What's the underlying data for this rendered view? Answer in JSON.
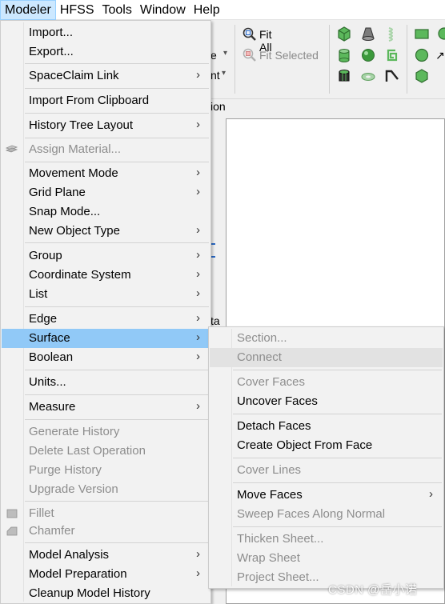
{
  "menubar": {
    "items": [
      "Modeler",
      "HFSS",
      "Tools",
      "Window",
      "Help"
    ]
  },
  "toolbar": {
    "fit_all": "Fit All",
    "fit_selected": "Fit Selected",
    "partial_label_1": "e",
    "partial_label_2": "nt",
    "partial_label_3": "ion",
    "partial_label_4": "ta"
  },
  "main_menu": {
    "items": [
      {
        "label": "Import...",
        "submenu": false,
        "enabled": true
      },
      {
        "label": "Export...",
        "submenu": false,
        "enabled": true
      },
      {
        "label": "SpaceClaim Link",
        "submenu": true,
        "enabled": true
      },
      {
        "label": "Import From Clipboard",
        "submenu": false,
        "enabled": true
      },
      {
        "label": "History Tree Layout",
        "submenu": true,
        "enabled": true
      },
      {
        "label": "Assign Material...",
        "submenu": false,
        "enabled": false
      },
      {
        "label": "Movement Mode",
        "submenu": true,
        "enabled": true
      },
      {
        "label": "Grid Plane",
        "submenu": true,
        "enabled": true
      },
      {
        "label": "Snap Mode...",
        "submenu": false,
        "enabled": true
      },
      {
        "label": "New Object Type",
        "submenu": true,
        "enabled": true
      },
      {
        "label": "Group",
        "submenu": true,
        "enabled": true
      },
      {
        "label": "Coordinate System",
        "submenu": true,
        "enabled": true
      },
      {
        "label": "List",
        "submenu": true,
        "enabled": true
      },
      {
        "label": "Edge",
        "submenu": true,
        "enabled": true
      },
      {
        "label": "Surface",
        "submenu": true,
        "enabled": true,
        "highlighted": true
      },
      {
        "label": "Boolean",
        "submenu": true,
        "enabled": true
      },
      {
        "label": "Units...",
        "submenu": false,
        "enabled": true
      },
      {
        "label": "Measure",
        "submenu": true,
        "enabled": true
      },
      {
        "label": "Generate History",
        "submenu": false,
        "enabled": false
      },
      {
        "label": "Delete Last Operation",
        "submenu": false,
        "enabled": false
      },
      {
        "label": "Purge History",
        "submenu": false,
        "enabled": false
      },
      {
        "label": "Upgrade Version",
        "submenu": false,
        "enabled": false
      },
      {
        "label": "Fillet",
        "submenu": false,
        "enabled": false
      },
      {
        "label": "Chamfer",
        "submenu": false,
        "enabled": false
      },
      {
        "label": "Model Analysis",
        "submenu": true,
        "enabled": true
      },
      {
        "label": "Model Preparation",
        "submenu": true,
        "enabled": true
      },
      {
        "label": "Cleanup Model History",
        "submenu": false,
        "enabled": true
      }
    ]
  },
  "surface_menu": {
    "items": [
      {
        "label": "Section...",
        "submenu": false,
        "enabled": false
      },
      {
        "label": "Connect",
        "submenu": false,
        "enabled": false,
        "hover": true
      },
      {
        "label": "Cover Faces",
        "submenu": false,
        "enabled": false
      },
      {
        "label": "Uncover Faces",
        "submenu": false,
        "enabled": true
      },
      {
        "label": "Detach Faces",
        "submenu": false,
        "enabled": true
      },
      {
        "label": "Create Object From Face",
        "submenu": false,
        "enabled": true
      },
      {
        "label": "Cover Lines",
        "submenu": false,
        "enabled": false
      },
      {
        "label": "Move Faces",
        "submenu": true,
        "enabled": true
      },
      {
        "label": "Sweep Faces Along Normal",
        "submenu": false,
        "enabled": false
      },
      {
        "label": "Thicken Sheet...",
        "submenu": false,
        "enabled": false
      },
      {
        "label": "Wrap Sheet",
        "submenu": false,
        "enabled": false
      },
      {
        "label": "Project Sheet...",
        "submenu": false,
        "enabled": false
      }
    ]
  },
  "submenu_arrow": "›",
  "watermark": "CSDN @岳小诺",
  "colors": {
    "highlight": "#91c9f7",
    "menubar_active": "#cce8ff",
    "disabled_text": "#8d8d8d",
    "icon_green": "#3c9a3c"
  }
}
